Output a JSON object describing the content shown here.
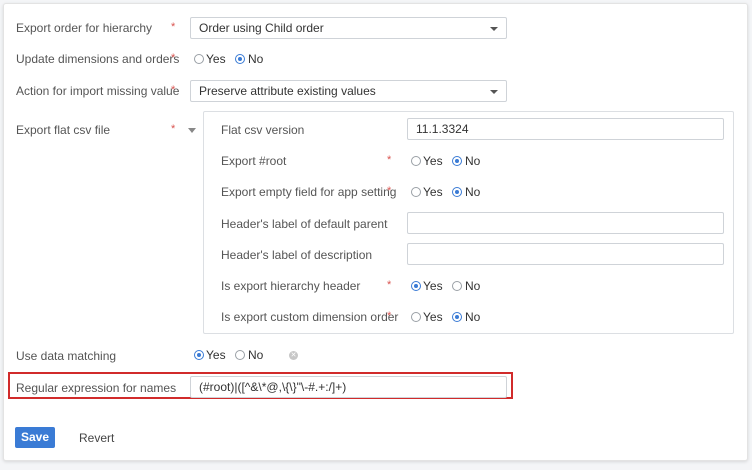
{
  "form": {
    "export_order": {
      "label": "Export order for hierarchy",
      "required": "*",
      "value": "Order using Child order"
    },
    "update_dimensions": {
      "label": "Update dimensions and orders",
      "required": "*",
      "yes": "Yes",
      "no": "No",
      "selected": "No"
    },
    "action_import_missing": {
      "label": "Action for import missing value",
      "required": "*",
      "value": "Preserve attribute existing values"
    },
    "export_flat_csv": {
      "label": "Export flat csv file",
      "required": "*",
      "fields": {
        "flat_csv_version": {
          "label": "Flat csv version",
          "value": "11.1.3324"
        },
        "export_root": {
          "label": "Export #root",
          "required": "*",
          "yes": "Yes",
          "no": "No",
          "selected": "No"
        },
        "export_empty_field": {
          "label": "Export empty field for app setting",
          "required": "*",
          "yes": "Yes",
          "no": "No",
          "selected": "No"
        },
        "header_default_parent": {
          "label": "Header's label of default parent",
          "value": ""
        },
        "header_description": {
          "label": "Header's label of description",
          "value": ""
        },
        "export_hierarchy_header": {
          "label": "Is export hierarchy header",
          "required": "*",
          "yes": "Yes",
          "no": "No",
          "selected": "Yes"
        },
        "export_custom_dimension_order": {
          "label": "Is export custom dimension order",
          "required": "*",
          "yes": "Yes",
          "no": "No",
          "selected": "No"
        }
      }
    },
    "use_data_matching": {
      "label": "Use data matching",
      "yes": "Yes",
      "no": "No",
      "selected": "Yes"
    },
    "regex_names": {
      "label": "Regular expression for names",
      "value": "(#root)|([^&\\*@,\\{\\}\"\\-#.+:/]+)"
    }
  },
  "actions": {
    "save": "Save",
    "revert": "Revert"
  },
  "icons": {
    "caret": "chevron-down-icon",
    "clear": "clear-icon"
  },
  "colors": {
    "accent": "#3a7bd5",
    "required": "#d9534f",
    "highlight": "#d12b2b"
  }
}
